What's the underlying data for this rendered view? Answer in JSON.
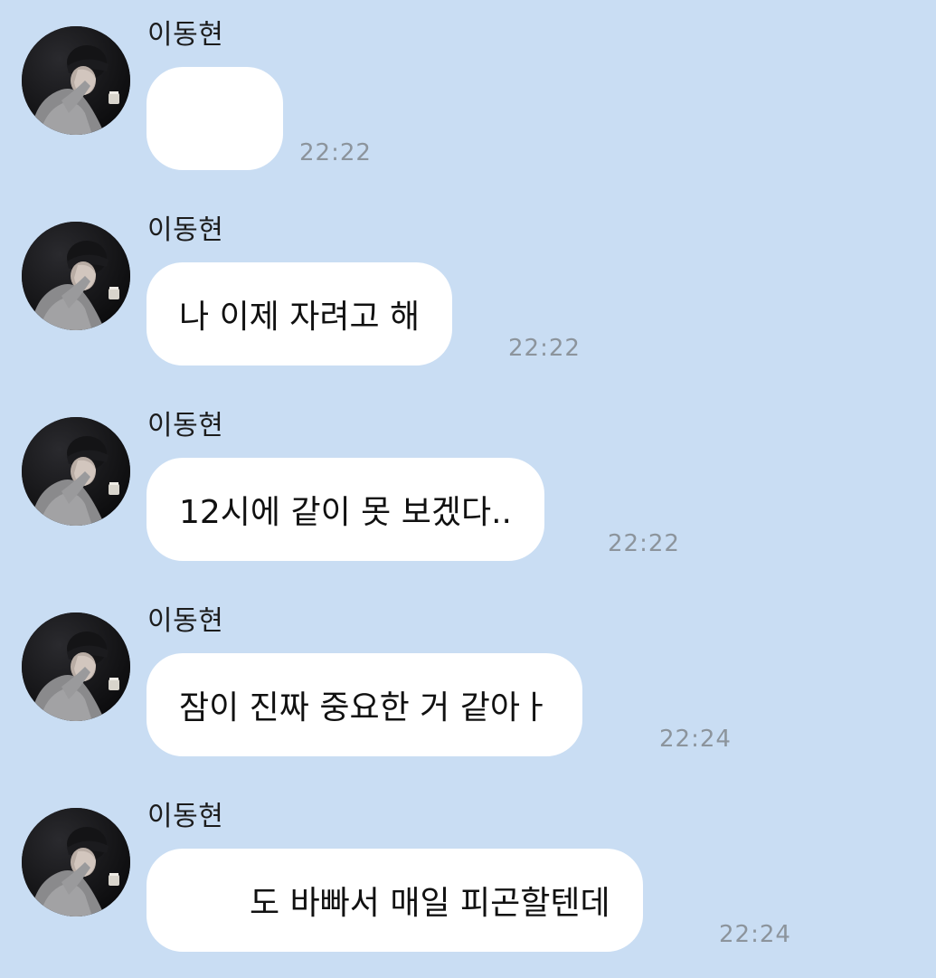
{
  "chat": {
    "messages": [
      {
        "sender": "이동현",
        "text": "",
        "time": "22:22"
      },
      {
        "sender": "이동현",
        "text": "나 이제 자려고 해",
        "time": "22:22"
      },
      {
        "sender": "이동현",
        "text": "12시에 같이 못 보겠다..",
        "time": "22:22"
      },
      {
        "sender": "이동현",
        "text": "잠이 진짜 중요한 거 같아ㅏ",
        "time": "22:24"
      },
      {
        "sender": "이동현",
        "text": "도 바빠서 매일 피곤할텐데",
        "time": "22:24"
      }
    ]
  },
  "colors": {
    "background": "#c9ddf3",
    "bubble": "#ffffff",
    "timestamp": "#8c949c"
  },
  "icons": {
    "avatar": "profile-photo-avatar"
  }
}
